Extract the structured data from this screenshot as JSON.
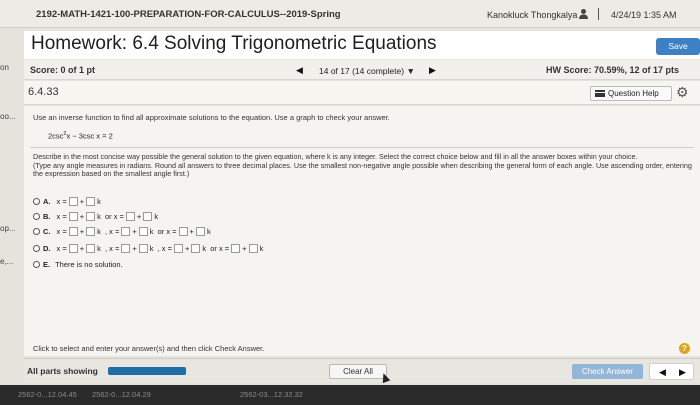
{
  "header": {
    "course": "2192-MATH-1421-100-PREPARATION-FOR-CALCULUS--2019-Spring",
    "user": "Kanokluck Thongkalya",
    "separator": "|",
    "datetime": "4/24/19 1:35 AM"
  },
  "title": {
    "text": "Homework: 6.4 Solving Trigonometric Equations",
    "save_label": "Save"
  },
  "side_fragments": [
    "on",
    "oo...",
    "op...",
    "e,..."
  ],
  "score": {
    "label": "Score: 0 of 1 pt",
    "progress_text": "14 of 17 (14 complete)",
    "hw_score": "HW Score: 70.59%, 12 of 17 pts"
  },
  "question": {
    "id": "6.4.33",
    "help_label": "Question Help",
    "instructions": "Use an inverse function to find all approximate solutions to the equation. Use a graph to check your answer.",
    "equation_part1": "2csc",
    "equation_sup": "2",
    "equation_part2": "x − 3csc x = 2",
    "describe_line1": "Describe in the most concise way possible the general solution to the given equation, where k is any integer. Select the correct choice below and fill in all the answer boxes within your choice.",
    "describe_line2": "(Type any angle measures in radians. Round all answers to three decimal places. Use the smallest non-negative angle possible when describing the general form of each angle. Use ascending order, entering the expression based on the smallest angle first.)"
  },
  "choices": [
    {
      "letter": "A.",
      "terms": 1
    },
    {
      "letter": "B.",
      "terms": 2
    },
    {
      "letter": "C.",
      "terms": 3
    },
    {
      "letter": "D.",
      "terms": 4
    },
    {
      "letter": "E.",
      "text": "There is no solution."
    }
  ],
  "choice_tokens": {
    "x_eq": "x =",
    "plus": "+",
    "k": "k",
    "sep": ", x =",
    "or": "or x ="
  },
  "footer": {
    "prompt": "Click to select and enter your answer(s) and then click Check Answer.",
    "help_symbol": "?",
    "all_parts": "All parts showing",
    "progress_fraction": 1.0,
    "clear_all": "Clear All",
    "check_answer": "Check Answer"
  },
  "taskbar": [
    "2562-0...12.04.45",
    "2562-0...12.04.29",
    "2562-03...12.32.32"
  ]
}
